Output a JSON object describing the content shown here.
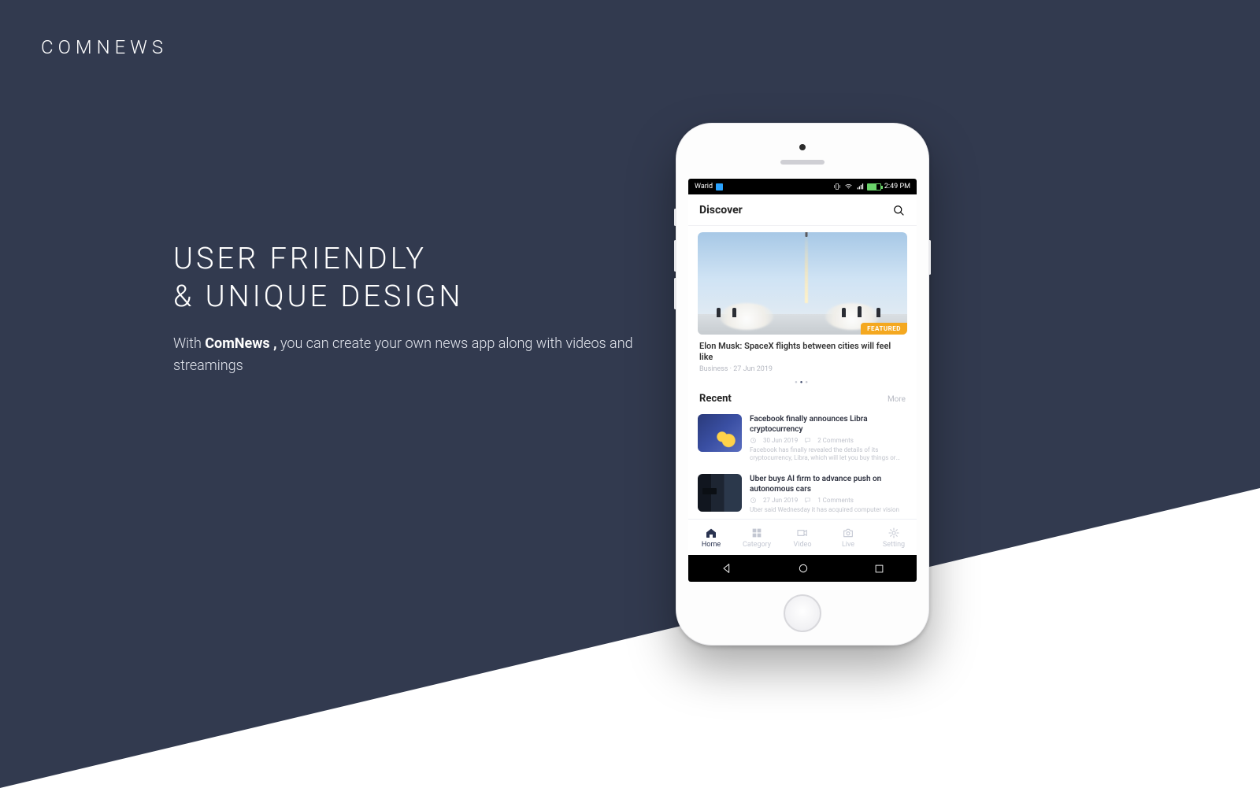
{
  "brand": "COMNEWS",
  "hero": {
    "headline_line1": "USER FRIENDLY",
    "headline_line2": "& UNIQUE DESIGN",
    "subtext_prefix": "With ",
    "subtext_brand": "ComNews ,",
    "subtext_suffix": "  you can create your own news app along with videos and streamings"
  },
  "statusbar": {
    "carrier": "Warid",
    "time": "2:49 PM"
  },
  "app": {
    "header_title": "Discover",
    "featured": {
      "badge": "FEATURED",
      "title": "Elon Musk: SpaceX flights between cities will feel like",
      "meta": "Business · 27 Jun 2019"
    },
    "recent": {
      "heading": "Recent",
      "more_label": "More",
      "items": [
        {
          "title": "Facebook finally announces Libra cryptocurrency",
          "date": "30 Jun 2019",
          "comments": "2 Comments",
          "excerpt": "Facebook has finally revealed the details of its cryptocurrency, Libra, which will let you buy things or send money to people with nearly zero fees."
        },
        {
          "title": "Uber buys AI firm to advance push on autonomous cars",
          "date": "27 Jun 2019",
          "comments": "1 Comments",
          "excerpt": "Uber said Wednesday it has acquired computer vision"
        }
      ]
    },
    "tabs": [
      {
        "label": "Home"
      },
      {
        "label": "Category"
      },
      {
        "label": "Video"
      },
      {
        "label": "Live"
      },
      {
        "label": "Setting"
      }
    ]
  }
}
